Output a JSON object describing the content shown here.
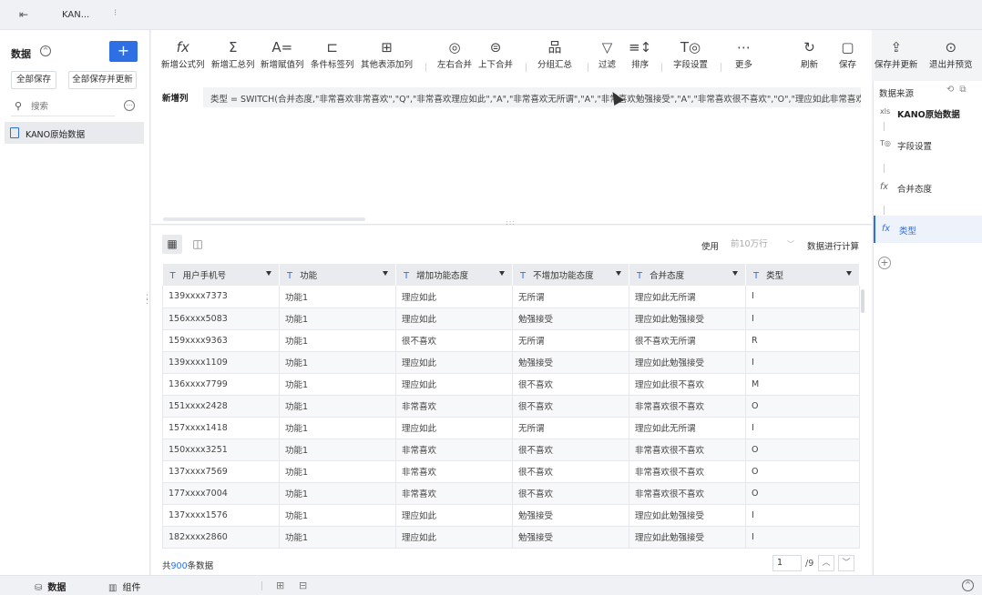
{
  "tab": {
    "title": "KAN..."
  },
  "sidebar": {
    "title": "数据",
    "add_label": "+",
    "save_all": "全部保存",
    "save_all_update": "全部保存并更新",
    "search_placeholder": "搜索",
    "items": [
      {
        "label": "KANO原始数据"
      }
    ]
  },
  "toolbar": {
    "tools": [
      {
        "icon": "fx",
        "label": "新增公式列"
      },
      {
        "icon": "Σ",
        "label": "新增汇总列"
      },
      {
        "icon": "A=",
        "label": "新增赋值列"
      },
      {
        "icon": "⊏",
        "label": "条件标签列"
      },
      {
        "icon": "⊞",
        "label": "其他表添加列"
      },
      {
        "icon": "◎",
        "label": "左右合并"
      },
      {
        "icon": "⊜",
        "label": "上下合并"
      },
      {
        "icon": "品",
        "label": "分组汇总"
      },
      {
        "icon": "▽",
        "label": "过滤"
      },
      {
        "icon": "≡↕",
        "label": "排序"
      },
      {
        "icon": "T◎",
        "label": "字段设置"
      },
      {
        "icon": "⋯",
        "label": "更多"
      }
    ],
    "actions": [
      {
        "icon": "↻",
        "label": "刷新"
      },
      {
        "icon": "▢",
        "label": "保存"
      },
      {
        "icon": "⇪",
        "label": "保存并更新"
      },
      {
        "icon": "⊙",
        "label": "退出并预览"
      }
    ]
  },
  "formula": {
    "label": "新增列",
    "text": "类型 = SWITCH(合并态度,\"非常喜欢非常喜欢\",\"Q\",\"非常喜欢理应如此\",\"A\",\"非常喜欢无所谓\",\"A\",\"非常喜欢勉强接受\",\"A\",\"非常喜欢很不喜欢\",\"O\",\"理应如此非常喜欢\",\"R"
  },
  "table_view": {
    "use_label": "使用",
    "use_value": "前10万行",
    "calc_label": "数据进行计算",
    "columns": [
      "用户手机号",
      "功能",
      "增加功能态度",
      "不增加功能态度",
      "合并态度",
      "类型"
    ],
    "rows": [
      [
        "139xxxx7373",
        "功能1",
        "理应如此",
        "无所谓",
        "理应如此无所谓",
        "I"
      ],
      [
        "156xxxx5083",
        "功能1",
        "理应如此",
        "勉强接受",
        "理应如此勉强接受",
        "I"
      ],
      [
        "159xxxx9363",
        "功能1",
        "很不喜欢",
        "无所谓",
        "很不喜欢无所谓",
        "R"
      ],
      [
        "139xxxx1109",
        "功能1",
        "理应如此",
        "勉强接受",
        "理应如此勉强接受",
        "I"
      ],
      [
        "136xxxx7799",
        "功能1",
        "理应如此",
        "很不喜欢",
        "理应如此很不喜欢",
        "M"
      ],
      [
        "151xxxx2428",
        "功能1",
        "非常喜欢",
        "很不喜欢",
        "非常喜欢很不喜欢",
        "O"
      ],
      [
        "157xxxx1418",
        "功能1",
        "理应如此",
        "无所谓",
        "理应如此无所谓",
        "I"
      ],
      [
        "150xxxx3251",
        "功能1",
        "非常喜欢",
        "很不喜欢",
        "非常喜欢很不喜欢",
        "O"
      ],
      [
        "137xxxx7569",
        "功能1",
        "非常喜欢",
        "很不喜欢",
        "非常喜欢很不喜欢",
        "O"
      ],
      [
        "177xxxx7004",
        "功能1",
        "非常喜欢",
        "很不喜欢",
        "非常喜欢很不喜欢",
        "O"
      ],
      [
        "137xxxx1576",
        "功能1",
        "理应如此",
        "勉强接受",
        "理应如此勉强接受",
        "I"
      ],
      [
        "182xxxx2860",
        "功能1",
        "理应如此",
        "勉强接受",
        "理应如此勉强接受",
        "I"
      ]
    ],
    "footer_prefix": "共",
    "footer_count": "900",
    "footer_suffix": "条数据",
    "page": "1",
    "page_total": "/9"
  },
  "right_panel": {
    "title": "数据来源",
    "steps": [
      {
        "icon": "xls",
        "label": "KANO原始数据"
      },
      {
        "icon": "T◎",
        "label": "字段设置"
      },
      {
        "icon": "fx",
        "label": "合并态度"
      },
      {
        "icon": "fx",
        "label": "类型"
      }
    ]
  },
  "bottombar": {
    "tab_data": "数据",
    "tab_component": "组件"
  },
  "colors": {
    "accent": "#2f6fe4"
  }
}
